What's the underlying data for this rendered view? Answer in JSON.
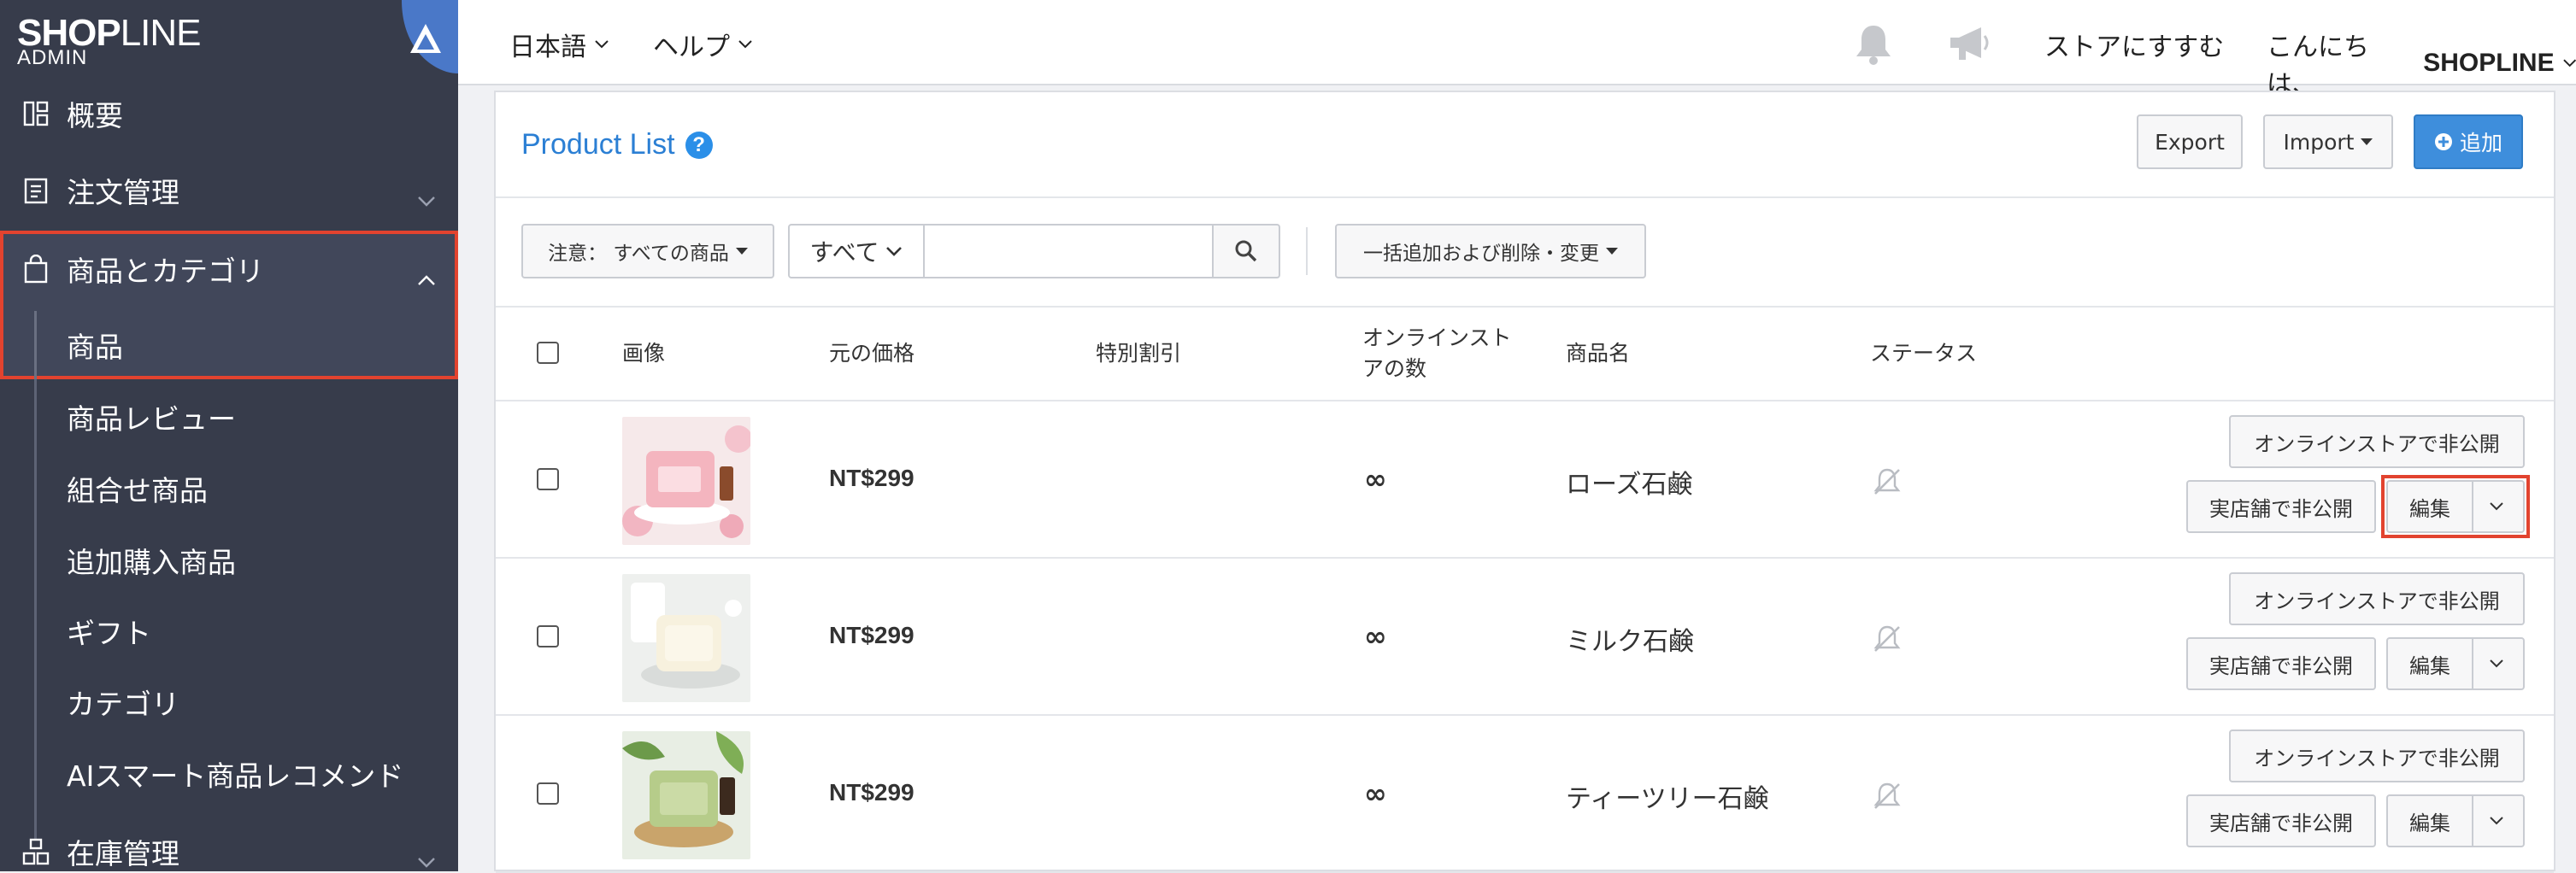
{
  "brand": {
    "name_bold": "SHOP",
    "name_light": "LINE",
    "subtitle": "ADMIN"
  },
  "sidebar": {
    "items": [
      {
        "label": "概要",
        "icon": "dashboard-icon"
      },
      {
        "label": "注文管理",
        "icon": "clipboard-icon"
      },
      {
        "label": "商品とカテゴリ",
        "icon": "shopping-bag-icon"
      },
      {
        "label": "在庫管理",
        "icon": "warehouse-icon"
      }
    ],
    "sub_items": [
      {
        "label": "商品"
      },
      {
        "label": "商品レビュー"
      },
      {
        "label": "組合せ商品"
      },
      {
        "label": "追加購入商品"
      },
      {
        "label": "ギフト"
      },
      {
        "label": "カテゴリ"
      },
      {
        "label": "AIスマート商品レコメンド"
      }
    ]
  },
  "topbar": {
    "language": "日本語",
    "help": "ヘルプ",
    "store_link": "ストアにすすむ",
    "greeting": "こんにちは、",
    "username": "SHOPLINE"
  },
  "panel": {
    "title": "Product List",
    "help_glyph": "?",
    "export_label": "Export",
    "import_label": "Import",
    "add_label": "追加",
    "filter_label": "注意： すべての商品",
    "scope_label": "すべて",
    "search_value": "",
    "bulk_label": "一括追加および削除・変更"
  },
  "table": {
    "headers": {
      "image": "画像",
      "price": "元の価格",
      "discount": "特別割引",
      "stock_line1": "オンラインスト",
      "stock_line2": "アの数",
      "name": "商品名",
      "status": "ステータス"
    },
    "rows": [
      {
        "price": "NT$299",
        "stock": "∞",
        "name": "ローズ石鹸",
        "hide_online": "オンラインストアで非公開",
        "hide_offline": "実店舗で非公開",
        "edit": "編集",
        "image": "rose-soap-image"
      },
      {
        "price": "NT$299",
        "stock": "∞",
        "name": "ミルク石鹸",
        "hide_online": "オンラインストアで非公開",
        "hide_offline": "実店舗で非公開",
        "edit": "編集",
        "image": "milk-soap-image"
      },
      {
        "price": "NT$299",
        "stock": "∞",
        "name": "ティーツリー石鹸",
        "hide_online": "オンラインストアで非公開",
        "hide_offline": "実店舗で非公開",
        "edit": "編集",
        "image": "tea-tree-soap-image"
      }
    ]
  },
  "colors": {
    "sidebar_bg": "#373c4b",
    "accent_blue": "#3e8edc",
    "highlight_red": "#e2432f"
  }
}
